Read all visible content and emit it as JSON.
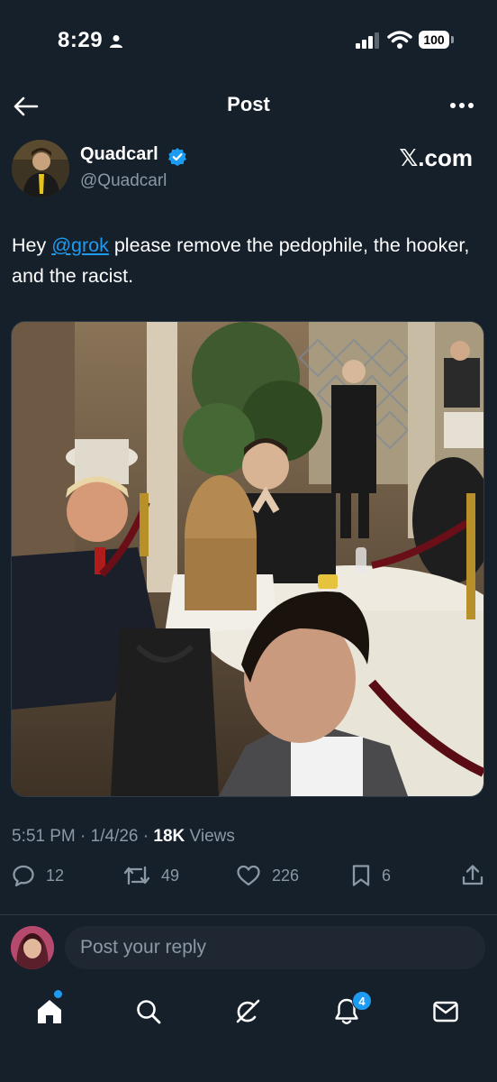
{
  "status_bar": {
    "time": "8:29",
    "battery": "100"
  },
  "header": {
    "title": "Post"
  },
  "post": {
    "author": {
      "display_name": "Quadcarl",
      "handle": "@Quadcarl",
      "verified": true
    },
    "source_link": "𝕏.com",
    "text_parts": {
      "greeting": "Hey ",
      "mention": "@grok",
      "body": " please remove the pedophile, the hooker, and the racist."
    },
    "meta": {
      "time": "5:51 PM",
      "separator": " · ",
      "date": "1/4/26",
      "views_count": "18K",
      "views_label": " Views"
    },
    "actions": {
      "replies": "12",
      "reposts": "49",
      "likes": "226",
      "bookmarks": "6"
    }
  },
  "reply": {
    "placeholder": "Post your reply"
  },
  "bottom_nav": {
    "items": [
      "home-icon",
      "search-icon",
      "grok-icon",
      "notifications-icon",
      "messages-icon"
    ],
    "notifications_badge": "4"
  },
  "colors": {
    "background": "#15202b",
    "accent": "#1d9bf0",
    "muted": "#8b98a5"
  }
}
